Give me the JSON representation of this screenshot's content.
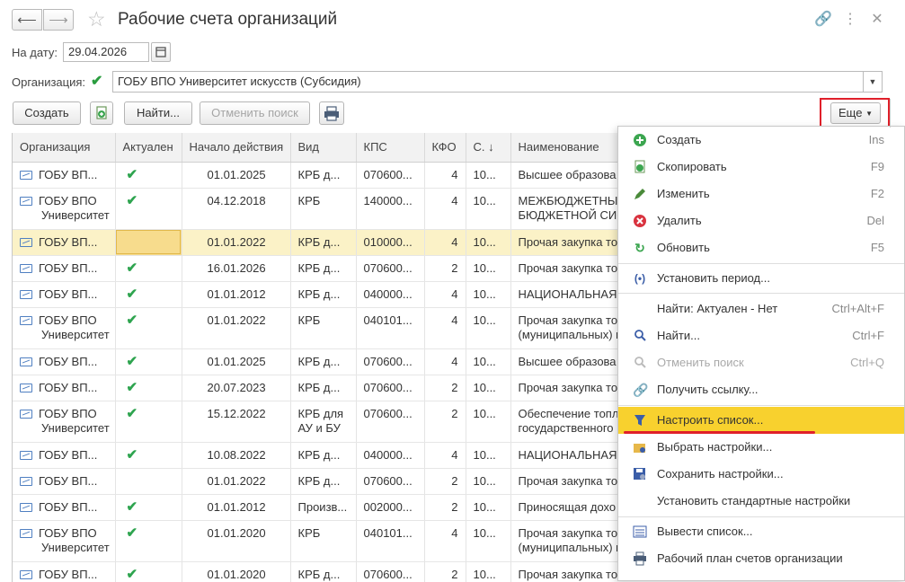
{
  "window": {
    "title": "Рабочие счета организаций"
  },
  "filters": {
    "date_label": "На дату:",
    "date_value": "29.04.2026",
    "org_label": "Организация:",
    "org_value": "ГОБУ ВПО Университет искусств (Субсидия)"
  },
  "toolbar": {
    "create_label": "Создать",
    "find_label": "Найти...",
    "cancel_search_label": "Отменить поиск",
    "more_label": "Еще"
  },
  "table": {
    "columns": [
      "Организация",
      "Актуален",
      "Начало действия",
      "Вид",
      "КПС",
      "КФО",
      "С. ↓",
      "Наименование"
    ],
    "rows": [
      {
        "org": "ГОБУ ВП...",
        "org2": "",
        "active": "✔",
        "start": "01.01.2025",
        "kind": "КРБ д...",
        "kind2": "",
        "kps": "070600...",
        "kfo": "4",
        "s": "10...",
        "name": "Высшее образова",
        "name2": ""
      },
      {
        "org": "ГОБУ ВПО",
        "org2": "Университет",
        "active": "✔",
        "start": "04.12.2018",
        "kind": "КРБ",
        "kind2": "",
        "kps": "140000...",
        "kfo": "4",
        "s": "10...",
        "name": "МЕЖБЮДЖЕТНЫ",
        "name2": "БЮДЖЕТНОЙ СИС"
      },
      {
        "org": "ГОБУ ВП...",
        "org2": "",
        "active": "",
        "start": "01.01.2022",
        "kind": "КРБ д...",
        "kind2": "",
        "kps": "010000...",
        "kfo": "4",
        "s": "10...",
        "name": "Прочая закупка то",
        "name2": ""
      },
      {
        "org": "ГОБУ ВП...",
        "org2": "",
        "active": "✔",
        "start": "16.01.2026",
        "kind": "КРБ д...",
        "kind2": "",
        "kps": "070600...",
        "kfo": "2",
        "s": "10...",
        "name": "Прочая закупка то",
        "name2": ""
      },
      {
        "org": "ГОБУ ВП...",
        "org2": "",
        "active": "✔",
        "start": "01.01.2012",
        "kind": "КРБ д...",
        "kind2": "",
        "kps": "040000...",
        "kfo": "4",
        "s": "10...",
        "name": "НАЦИОНАЛЬНАЯ",
        "name2": ""
      },
      {
        "org": "ГОБУ ВПО",
        "org2": "Университет",
        "active": "✔",
        "start": "01.01.2022",
        "kind": "КРБ",
        "kind2": "",
        "kps": "040101...",
        "kfo": "4",
        "s": "10...",
        "name": "Прочая закупка то",
        "name2": "(муниципальных) н"
      },
      {
        "org": "ГОБУ ВП...",
        "org2": "",
        "active": "✔",
        "start": "01.01.2025",
        "kind": "КРБ д...",
        "kind2": "",
        "kps": "070600...",
        "kfo": "4",
        "s": "10...",
        "name": "Высшее образова",
        "name2": ""
      },
      {
        "org": "ГОБУ ВП...",
        "org2": "",
        "active": "✔",
        "start": "20.07.2023",
        "kind": "КРБ д...",
        "kind2": "",
        "kps": "070600...",
        "kfo": "2",
        "s": "10...",
        "name": "Прочая закупка то",
        "name2": ""
      },
      {
        "org": "ГОБУ ВПО",
        "org2": "Университет",
        "active": "✔",
        "start": "15.12.2022",
        "kind": "КРБ для",
        "kind2": "АУ и БУ",
        "kps": "070600...",
        "kfo": "2",
        "s": "10...",
        "name": "Обеспечение топл",
        "name2": "государственного"
      },
      {
        "org": "ГОБУ ВП...",
        "org2": "",
        "active": "✔",
        "start": "10.08.2022",
        "kind": "КРБ д...",
        "kind2": "",
        "kps": "040000...",
        "kfo": "4",
        "s": "10...",
        "name": "НАЦИОНАЛЬНАЯ",
        "name2": ""
      },
      {
        "org": "ГОБУ ВП...",
        "org2": "",
        "active": "",
        "start": "01.01.2022",
        "kind": "КРБ д...",
        "kind2": "",
        "kps": "070600...",
        "kfo": "2",
        "s": "10...",
        "name": "Прочая закупка то",
        "name2": ""
      },
      {
        "org": "ГОБУ ВП...",
        "org2": "",
        "active": "✔",
        "start": "01.01.2012",
        "kind": "Произв...",
        "kind2": "",
        "kps": "002000...",
        "kfo": "2",
        "s": "10...",
        "name": "Приносящая дохо",
        "name2": ""
      },
      {
        "org": "ГОБУ ВПО",
        "org2": "Университет",
        "active": "✔",
        "start": "01.01.2020",
        "kind": "КРБ",
        "kind2": "",
        "kps": "040101...",
        "kfo": "4",
        "s": "10...",
        "name": "Прочая закупка то",
        "name2": "(муниципальных) н"
      },
      {
        "org": "ГОБУ ВП...",
        "org2": "",
        "active": "✔",
        "start": "01.01.2020",
        "kind": "КРБ д...",
        "kind2": "",
        "kps": "070600...",
        "kfo": "2",
        "s": "10...",
        "name": "Прочая закупка товаров, работ и услуг",
        "name2": ""
      }
    ]
  },
  "menu": {
    "items": [
      {
        "label": "Создать",
        "key": "Ins"
      },
      {
        "label": "Скопировать",
        "key": "F9"
      },
      {
        "label": "Изменить",
        "key": "F2"
      },
      {
        "label": "Удалить",
        "key": "Del"
      },
      {
        "label": "Обновить",
        "key": "F5"
      },
      {
        "label": "Установить период...",
        "key": ""
      },
      {
        "label": "Найти: Актуален - Нет",
        "key": "Ctrl+Alt+F"
      },
      {
        "label": "Найти...",
        "key": "Ctrl+F"
      },
      {
        "label": "Отменить поиск",
        "key": "Ctrl+Q"
      },
      {
        "label": "Получить ссылку...",
        "key": ""
      },
      {
        "label": "Настроить список...",
        "key": ""
      },
      {
        "label": "Выбрать настройки...",
        "key": ""
      },
      {
        "label": "Сохранить настройки...",
        "key": ""
      },
      {
        "label": "Установить стандартные настройки",
        "key": ""
      },
      {
        "label": "Вывести список...",
        "key": ""
      },
      {
        "label": "Рабочий план счетов организации",
        "key": ""
      }
    ]
  },
  "colors": {
    "highlight": "#f8d12e",
    "selected_row": "#fbf2c7",
    "annotation_red": "#e0202a",
    "check_green": "#2ea44f"
  }
}
